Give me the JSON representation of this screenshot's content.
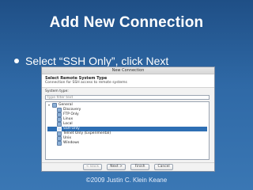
{
  "slide": {
    "title": "Add New Connection",
    "bullet_text": "Select “SSH Only”, click Next",
    "copyright": "©2009 Justin C. Klein Keane"
  },
  "dialog": {
    "window_title": "New Connection",
    "header_title": "Select Remote System Type",
    "header_desc": "Connection for SSH access to remote systems",
    "system_type_label": "System type:",
    "filter_placeholder": "type filter text",
    "tree": [
      {
        "label": "General",
        "indent": false,
        "expanded": true,
        "selected": false
      },
      {
        "label": "Discovery",
        "indent": true,
        "selected": false
      },
      {
        "label": "FTP Only",
        "indent": true,
        "selected": false
      },
      {
        "label": "Linux",
        "indent": true,
        "selected": false
      },
      {
        "label": "Local",
        "indent": true,
        "selected": false
      },
      {
        "label": "SSH Only",
        "indent": true,
        "selected": true
      },
      {
        "label": "Telnet Only (Experimental)",
        "indent": true,
        "selected": false
      },
      {
        "label": "Unix",
        "indent": true,
        "selected": false
      },
      {
        "label": "Windows",
        "indent": true,
        "selected": false
      }
    ],
    "buttons": {
      "back": "< Back",
      "next": "Next >",
      "finish": "Finish",
      "cancel": "Cancel"
    }
  }
}
